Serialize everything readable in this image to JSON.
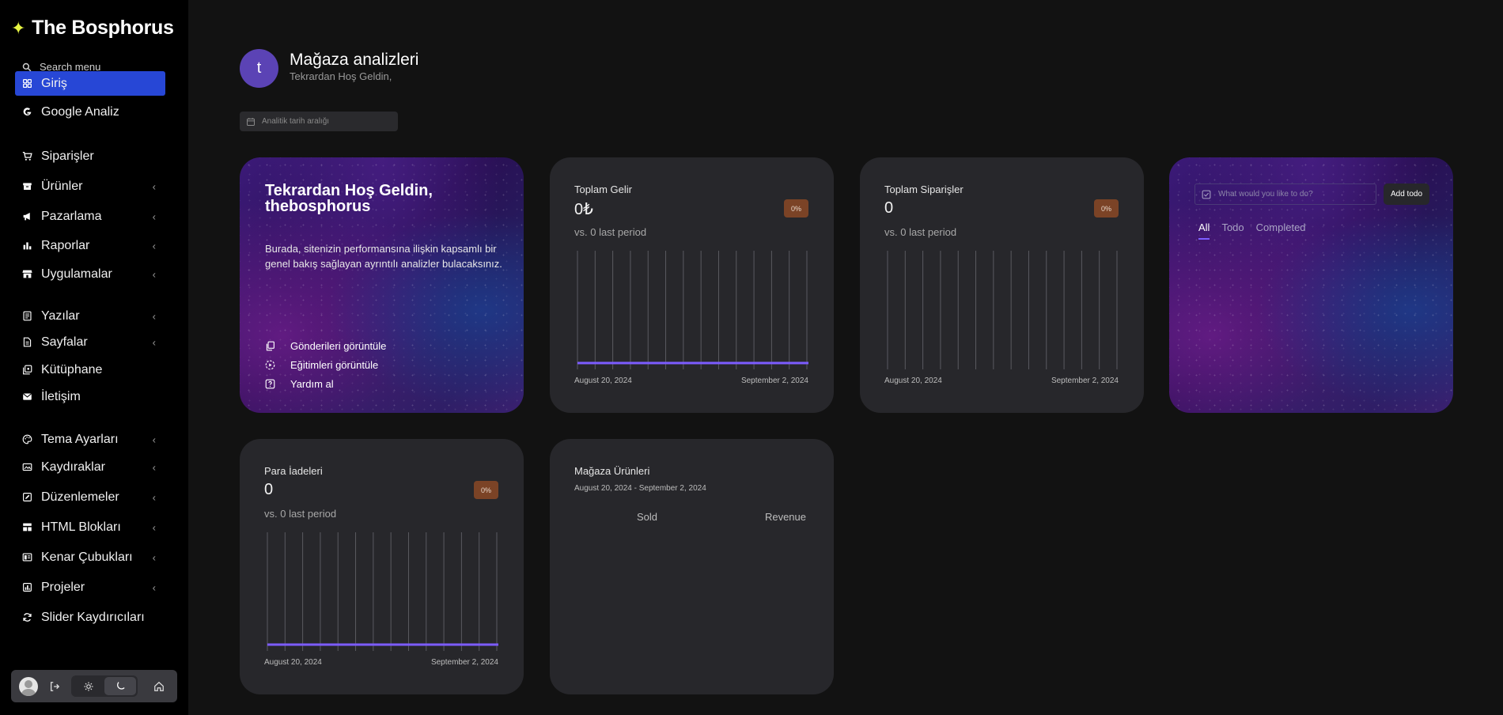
{
  "sidebar": {
    "logo": "The Bosphorus",
    "search_label": "Search menu",
    "items": [
      {
        "label": "Giriş",
        "icon": "grid-icon",
        "chevron": false,
        "active": true
      },
      {
        "label": "Google Analiz",
        "icon": "google-icon",
        "chevron": false
      },
      {
        "label": "Siparişler",
        "icon": "cart-icon",
        "chevron": false
      },
      {
        "label": "Ürünler",
        "icon": "box-icon",
        "chevron": true
      },
      {
        "label": "Pazarlama",
        "icon": "megaphone-icon",
        "chevron": true
      },
      {
        "label": "Raporlar",
        "icon": "bar-chart-icon",
        "chevron": true
      },
      {
        "label": "Uygulamalar",
        "icon": "store-icon",
        "chevron": true
      },
      {
        "label": "Yazılar",
        "icon": "document-icon",
        "chevron": true
      },
      {
        "label": "Sayfalar",
        "icon": "page-icon",
        "chevron": true
      },
      {
        "label": "Kütüphane",
        "icon": "library-icon",
        "chevron": false
      },
      {
        "label": "İletişim",
        "icon": "mail-icon",
        "chevron": false
      },
      {
        "label": "Tema Ayarları",
        "icon": "palette-icon",
        "chevron": true
      },
      {
        "label": "Kaydıraklar",
        "icon": "slides-icon",
        "chevron": true
      },
      {
        "label": "Düzenlemeler",
        "icon": "edit-icon",
        "chevron": true
      },
      {
        "label": "HTML Blokları",
        "icon": "blocks-icon",
        "chevron": true
      },
      {
        "label": "Kenar Çubukları",
        "icon": "sidebar-icon",
        "chevron": true
      },
      {
        "label": "Projeler",
        "icon": "projects-icon",
        "chevron": true
      },
      {
        "label": "Slider Kaydırıcıları",
        "icon": "refresh-icon",
        "chevron": false
      }
    ],
    "chevron_glyph": "‹"
  },
  "header": {
    "avatar_letter": "t",
    "title": "Mağaza analizleri",
    "subtitle": "Tekrardan Hoş Geldin,",
    "date_placeholder": "Analitik tarih aralığı"
  },
  "welcome": {
    "title_line1": "Tekrardan Hoş Geldin,",
    "title_line2": "thebosphorus",
    "description": "Burada, sitenizin performansına ilişkin kapsamlı bir genel bakış sağlayan ayrıntılı analizler bulacaksınız.",
    "links": [
      {
        "label": "Gönderileri görüntüle",
        "icon": "copy-icon"
      },
      {
        "label": "Eğitimleri görüntüle",
        "icon": "play-circle-icon"
      },
      {
        "label": "Yardım al",
        "icon": "help-icon"
      }
    ]
  },
  "stats": [
    {
      "label": "Toplam Gelir",
      "value": "0₺",
      "badge": "0%",
      "vs": "vs. 0 last period",
      "start": "August 20, 2024",
      "end": "September 2, 2024"
    },
    {
      "label": "Toplam Siparişler",
      "value": "0",
      "badge": "0%",
      "vs": "vs. 0 last period",
      "start": "August 20, 2024",
      "end": "September 2, 2024"
    },
    {
      "label": "Para İadeleri",
      "value": "0",
      "badge": "0%",
      "vs": "vs. 0 last period",
      "start": "August 20, 2024",
      "end": "September 2, 2024"
    }
  ],
  "todo": {
    "placeholder": "What would you like to do?",
    "button": "Add todo",
    "tabs": [
      "All",
      "Todo",
      "Completed"
    ],
    "active_tab": 0
  },
  "store": {
    "title": "Mağaza Ürünleri",
    "range": "August 20, 2024 - September 2, 2024",
    "col_sold": "Sold",
    "col_revenue": "Revenue"
  },
  "colors": {
    "accent": "#2747d6",
    "chart_line": "#7c5cff",
    "badge": "#7b4326",
    "avatar": "#5b43b5"
  }
}
